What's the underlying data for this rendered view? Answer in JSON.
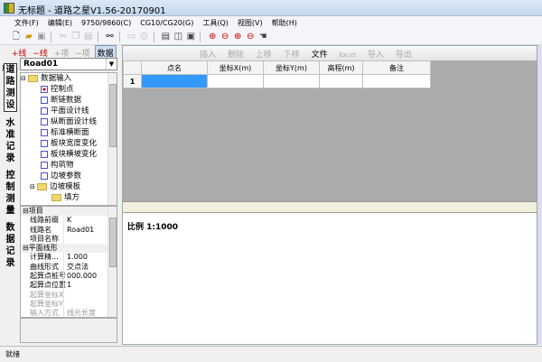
{
  "title": "无标题 - 道路之星V1.56-20170901",
  "menu": [
    "文件(F)",
    "编辑(E)",
    "9750/9860(C)",
    "CG10/CG20(G)",
    "工具(Q)",
    "视图(V)",
    "帮助(H)"
  ],
  "toolbar_icons": [
    "new-icon",
    "open-icon",
    "save-icon",
    "cut-icon",
    "copy-icon",
    "paste-icon",
    "find-icon",
    "print-preview-icon",
    "print-icon",
    "layout1-icon",
    "layout2-icon",
    "layout3-icon",
    "zoom-window-icon",
    "zoom-out-icon",
    "zoom-in-icon",
    "zoom-minus-icon",
    "pan-icon"
  ],
  "left_toolbar": {
    "add_line": "+线",
    "remove_line": "−线",
    "add_item": "+项",
    "remove_item": "−项",
    "data": "数据",
    "result": "成果"
  },
  "road_select": "Road01",
  "vertical_tabs": [
    "道路测设",
    "水准记录",
    "控制测量",
    "数据记录"
  ],
  "tree": {
    "root": "数据输入",
    "items": [
      "控制点",
      "断链数据",
      "平面设计线",
      "纵断面设计线",
      "标准横断面",
      "板块宽度变化",
      "板块横坡变化",
      "构筑物",
      "边坡参数"
    ],
    "sub": "边坡模板",
    "subitem": "填方"
  },
  "props": [
    {
      "cat": "项目"
    },
    {
      "k": "线路前缀",
      "v": "K"
    },
    {
      "k": "线路名",
      "v": "Road01"
    },
    {
      "k": "项目名称",
      "v": ""
    },
    {
      "cat": "平面线形"
    },
    {
      "k": "计算精...",
      "v": "1.000"
    },
    {
      "k": "曲线形式",
      "v": "交点法"
    },
    {
      "k": "起算点桩号",
      "v": "000.000"
    },
    {
      "k": "起算点位置",
      "v": "1"
    },
    {
      "k": "起算坐标X",
      "v": "",
      "dis": true
    },
    {
      "k": "起算坐标Y",
      "v": "",
      "dis": true
    },
    {
      "k": "输入方式",
      "v": "线元长度",
      "dis": true
    }
  ],
  "grid_toolbar": {
    "insert": "插入",
    "delete": "删除",
    "up": "上移",
    "down": "下移",
    "file": "文件",
    "excel": "Excel",
    "import": "导入",
    "export": "导出"
  },
  "grid": {
    "columns": [
      "点名",
      "坐标X(m)",
      "坐标Y(m)",
      "高程(m)",
      "备注"
    ],
    "rows": [
      [
        "1",
        "",
        "",
        "",
        "",
        ""
      ]
    ]
  },
  "scale": "比例 1:1000",
  "status": "就绪"
}
